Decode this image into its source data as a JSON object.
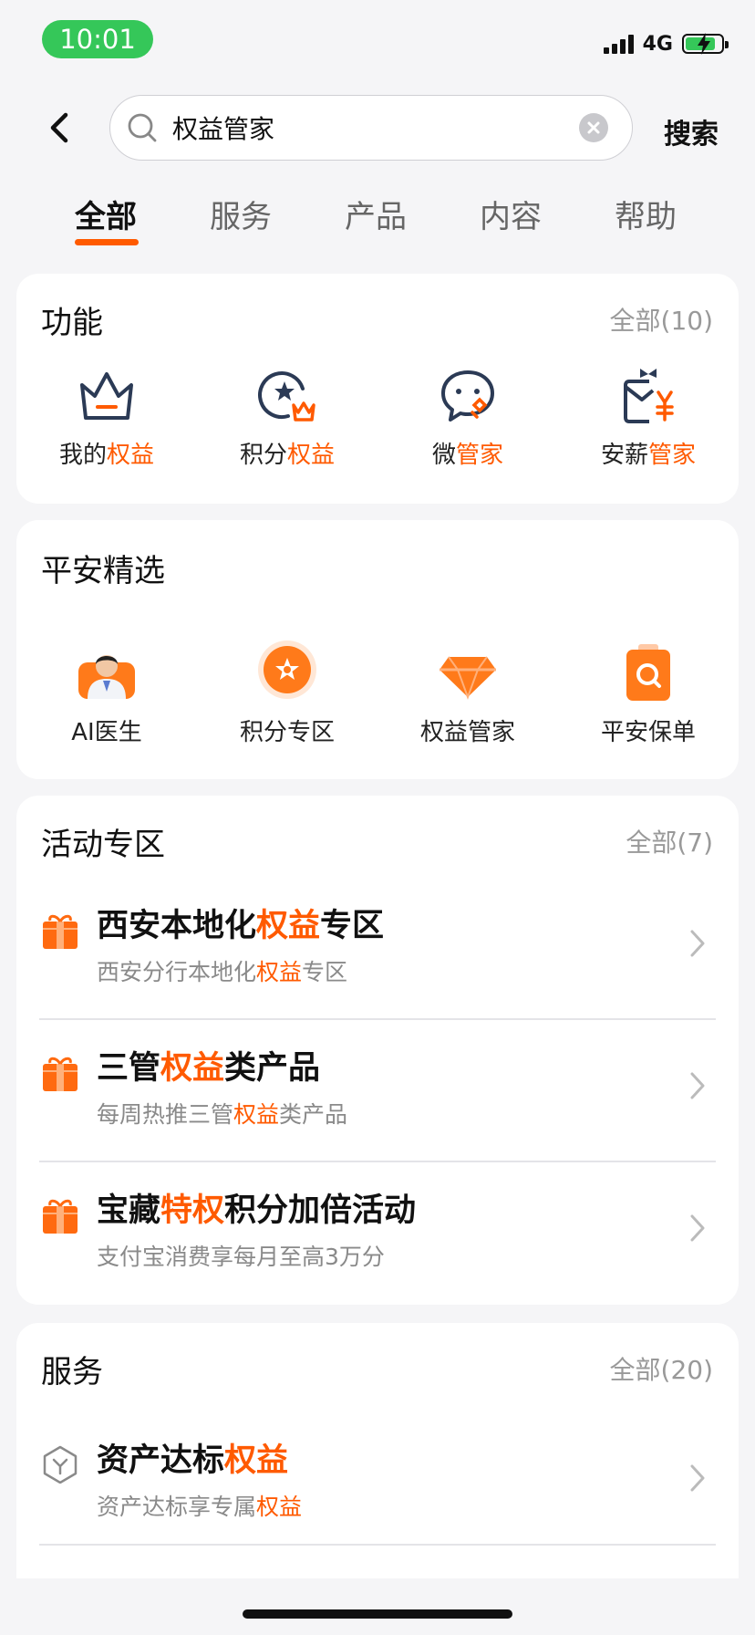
{
  "status": {
    "time": "10:01",
    "network": "4G"
  },
  "search": {
    "value": "权益管家",
    "button": "搜索"
  },
  "tabs": [
    {
      "label": "全部",
      "active": true
    },
    {
      "label": "服务"
    },
    {
      "label": "产品"
    },
    {
      "label": "内容"
    },
    {
      "label": "帮助"
    }
  ],
  "functions": {
    "title": "功能",
    "more": "全部(10)",
    "items": [
      {
        "prefix": "我的",
        "highlight": "权益",
        "icon": "crown-icon"
      },
      {
        "prefix": "积分",
        "highlight": "权益",
        "icon": "star-badge-icon"
      },
      {
        "prefix": "微",
        "highlight": "管家",
        "icon": "chat-bubble-icon"
      },
      {
        "prefix": "安薪",
        "highlight": "管家",
        "icon": "salary-gift-icon"
      }
    ]
  },
  "picks": {
    "title": "平安精选",
    "items": [
      {
        "label": "AI医生",
        "icon": "doctor-avatar-icon"
      },
      {
        "label": "积分专区",
        "icon": "points-star-icon"
      },
      {
        "label": "权益管家",
        "icon": "diamond-icon"
      },
      {
        "label": "平安保单",
        "icon": "policy-search-icon"
      }
    ]
  },
  "activities": {
    "title": "活动专区",
    "more": "全部(7)",
    "items": [
      {
        "t1": "西安本地化",
        "th": "权益",
        "t2": "专区",
        "s1": "西安分行本地化",
        "sh": "权益",
        "s2": "专区"
      },
      {
        "t1": "三管",
        "th": "权益",
        "t2": "类产品",
        "s1": "每周热推三管",
        "sh": "权益",
        "s2": "类产品"
      },
      {
        "t1": "宝藏",
        "th": "特权",
        "t2": "积分加倍活动",
        "s1": "支付宝消费享每月至高3万分",
        "sh": "",
        "s2": ""
      }
    ]
  },
  "services": {
    "title": "服务",
    "more": "全部(20)",
    "items": [
      {
        "t1": "资产达标",
        "th": "权益",
        "s1": "资产达标享专属",
        "sh": "权益"
      }
    ]
  },
  "colors": {
    "accent": "#ff5a00",
    "status_green": "#35c759",
    "background": "#f5f5f7"
  }
}
